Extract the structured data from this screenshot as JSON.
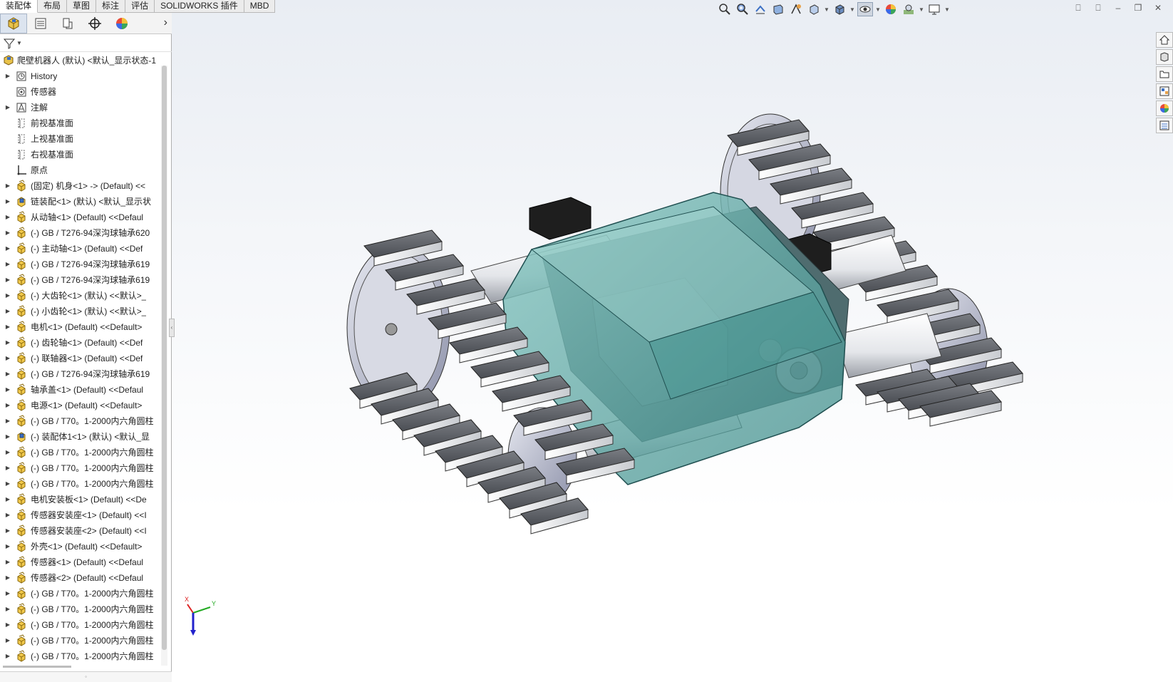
{
  "command_tabs": [
    {
      "label": "装配体",
      "active": true
    },
    {
      "label": "布局"
    },
    {
      "label": "草图"
    },
    {
      "label": "标注"
    },
    {
      "label": "评估"
    },
    {
      "label": "SOLIDWORKS 插件"
    },
    {
      "label": "MBD"
    }
  ],
  "tree": {
    "root": "爬壁机器人 (默认) <默认_显示状态-1",
    "items": [
      {
        "label": "History",
        "icon": "history-icon",
        "arrow": true
      },
      {
        "label": "传感器",
        "icon": "sensor-folder-icon",
        "arrow": false
      },
      {
        "label": "注解",
        "icon": "annotation-icon",
        "arrow": true
      },
      {
        "label": "前视基准面",
        "icon": "plane-icon",
        "arrow": false
      },
      {
        "label": "上视基准面",
        "icon": "plane-icon",
        "arrow": false
      },
      {
        "label": "右视基准面",
        "icon": "plane-icon",
        "arrow": false
      },
      {
        "label": "原点",
        "icon": "origin-icon",
        "arrow": false
      },
      {
        "label": "(固定) 机身<1> -> (Default) <<",
        "icon": "part-icon",
        "arrow": true
      },
      {
        "label": "链装配<1> (默认) <默认_显示状",
        "icon": "assembly-icon",
        "arrow": true
      },
      {
        "label": "从动轴<1> (Default) <<Defaul",
        "icon": "part-icon",
        "arrow": true
      },
      {
        "label": "(-) GB / T276-94深沟球轴承620",
        "icon": "part-icon",
        "arrow": true
      },
      {
        "label": "(-) 主动轴<1> (Default) <<Def",
        "icon": "part-icon",
        "arrow": true
      },
      {
        "label": "(-) GB / T276-94深沟球轴承619",
        "icon": "part-icon",
        "arrow": true
      },
      {
        "label": "(-) GB / T276-94深沟球轴承619",
        "icon": "part-icon",
        "arrow": true
      },
      {
        "label": "(-) 大齿轮<1> (默认) <<默认>_",
        "icon": "part-icon",
        "arrow": true
      },
      {
        "label": "(-) 小齿轮<1> (默认) <<默认>_",
        "icon": "part-icon",
        "arrow": true
      },
      {
        "label": "电机<1> (Default) <<Default>",
        "icon": "part-icon",
        "arrow": true
      },
      {
        "label": "(-) 齿轮轴<1> (Default) <<Def",
        "icon": "part-icon",
        "arrow": true
      },
      {
        "label": "(-) 联轴器<1> (Default) <<Def",
        "icon": "part-icon",
        "arrow": true
      },
      {
        "label": "(-) GB / T276-94深沟球轴承619",
        "icon": "part-icon",
        "arrow": true
      },
      {
        "label": "轴承盖<1> (Default) <<Defaul",
        "icon": "part-icon",
        "arrow": true
      },
      {
        "label": "电源<1> (Default) <<Default>",
        "icon": "part-icon",
        "arrow": true
      },
      {
        "label": "(-) GB / T70。1-2000内六角圆柱",
        "icon": "part-icon",
        "arrow": true
      },
      {
        "label": "(-) 装配体1<1> (默认) <默认_显",
        "icon": "assembly-icon",
        "arrow": true
      },
      {
        "label": "(-) GB / T70。1-2000内六角圆柱",
        "icon": "part-icon",
        "arrow": true
      },
      {
        "label": "(-) GB / T70。1-2000内六角圆柱",
        "icon": "part-icon",
        "arrow": true
      },
      {
        "label": "(-) GB / T70。1-2000内六角圆柱",
        "icon": "part-icon",
        "arrow": true
      },
      {
        "label": "电机安装板<1> (Default) <<De",
        "icon": "part-icon",
        "arrow": true
      },
      {
        "label": "传感器安装座<1> (Default) <<I",
        "icon": "part-icon",
        "arrow": true
      },
      {
        "label": "传感器安装座<2> (Default) <<I",
        "icon": "part-icon",
        "arrow": true
      },
      {
        "label": "外壳<1> (Default) <<Default>",
        "icon": "part-icon",
        "arrow": true
      },
      {
        "label": "传感器<1> (Default) <<Defaul",
        "icon": "part-icon",
        "arrow": true
      },
      {
        "label": "传感器<2> (Default) <<Defaul",
        "icon": "part-icon",
        "arrow": true
      },
      {
        "label": "(-) GB / T70。1-2000内六角圆柱",
        "icon": "part-icon",
        "arrow": true
      },
      {
        "label": "(-) GB / T70。1-2000内六角圆柱",
        "icon": "part-icon",
        "arrow": true
      },
      {
        "label": "(-) GB / T70。1-2000内六角圆柱",
        "icon": "part-icon",
        "arrow": true
      },
      {
        "label": "(-) GB / T70。1-2000内六角圆柱",
        "icon": "part-icon",
        "arrow": true
      },
      {
        "label": "(-) GB / T70。1-2000内六角圆柱",
        "icon": "part-icon",
        "arrow": true
      }
    ]
  },
  "triad": {
    "x": "X",
    "y": "Y"
  },
  "colors": {
    "housing": "#5fa6a3",
    "track": "#5a5d63",
    "blue_chain": "#2a3f8f"
  }
}
